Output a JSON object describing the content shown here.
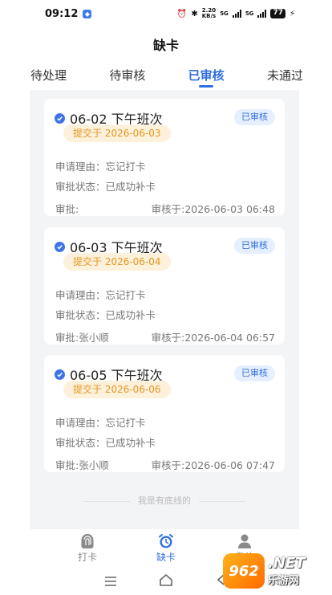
{
  "status_bar": {
    "time": "09:12",
    "net_speed": "2.20",
    "net_unit": "KB/s",
    "sig1": "5G",
    "sig2": "5G",
    "battery": "77"
  },
  "page_title": "缺卡",
  "tabs": [
    {
      "label": "待处理",
      "active": false
    },
    {
      "label": "待审核",
      "active": false
    },
    {
      "label": "已审核",
      "active": true
    },
    {
      "label": "未通过",
      "active": false
    }
  ],
  "cards": [
    {
      "title": "06-02 下午班次",
      "status": "已审核",
      "submitted": "提交于 2026-06-03",
      "reason": "申请理由：忘记打卡",
      "state": "审批状态：已成功补卡",
      "approver": "审批:",
      "reviewed": "审核于:2026-06-03 06:48"
    },
    {
      "title": "06-03 下午班次",
      "status": "已审核",
      "submitted": "提交于 2026-06-04",
      "reason": "申请理由：忘记打卡",
      "state": "审批状态：已成功补卡",
      "approver": "审批:张小顺",
      "reviewed": "审核于:2026-06-04 06:57"
    },
    {
      "title": "06-05 下午班次",
      "status": "已审核",
      "submitted": "提交于 2026-06-06",
      "reason": "申请理由：忘记打卡",
      "state": "审批状态：已成功补卡",
      "approver": "审批:张小顺",
      "reviewed": "审核于:2026-06-06 07:47"
    }
  ],
  "footer_note": "我是有底线的",
  "bottom_nav": [
    {
      "label": "打卡",
      "icon": "fingerprint-icon",
      "active": false
    },
    {
      "label": "缺卡",
      "icon": "alarm-clock-icon",
      "active": true
    },
    {
      "label": "我的",
      "icon": "user-icon",
      "active": false
    }
  ],
  "watermark": {
    "logo": "962",
    "domain": ".NET",
    "text": "乐游网"
  },
  "colors": {
    "accent": "#2f6fe0",
    "badge_bg": "#e6efff",
    "chip_bg": "#fdf1dc",
    "chip_text": "#e5961f"
  }
}
